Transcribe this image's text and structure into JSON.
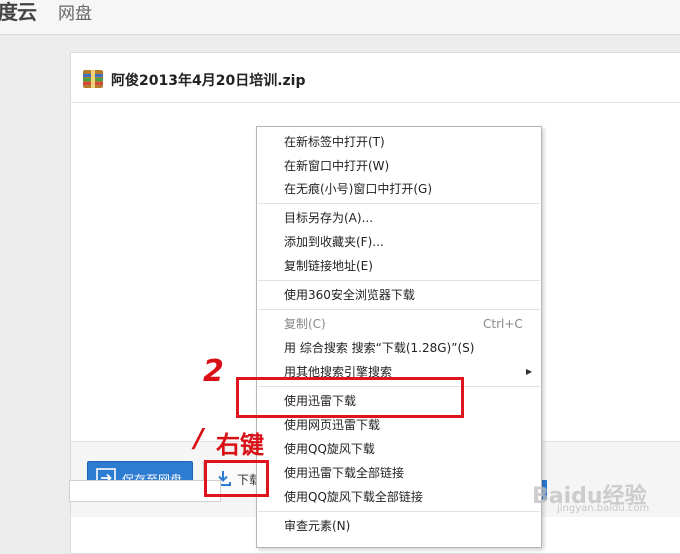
{
  "header": {
    "logo": "度云",
    "title": "网盘"
  },
  "file": {
    "name": "阿俊2013年4月20日培训.zip",
    "icon": "zip-archive-icon"
  },
  "actions": {
    "save_label": "保存至网盘",
    "download_label": "下载"
  },
  "context_menu": {
    "open_new_tab": "在新标签中打开(T)",
    "open_new_window": "在新窗口中打开(W)",
    "open_incognito": "在无痕(小号)窗口中打开(G)",
    "save_as": "目标另存为(A)...",
    "add_favorites": "添加到收藏夹(F)...",
    "copy_link": "复制链接地址(E)",
    "download_360": "使用360安全浏览器下载",
    "copy": "复制(C)",
    "copy_shortcut": "Ctrl+C",
    "search_selection": "用 综合搜索 搜索“下载(1.28G)”(S)",
    "other_search": "用其他搜索引擎搜索",
    "thunder_download": "使用迅雷下载",
    "web_thunder": "使用网页迅雷下载",
    "qq_download": "使用QQ旋风下载",
    "thunder_all": "使用迅雷下载全部链接",
    "qq_all": "使用QQ旋风下载全部链接",
    "inspect": "审查元素(N)"
  },
  "annotations": {
    "step2": "2",
    "step1": "/",
    "right_click": "右键",
    "color": "#d81016"
  },
  "watermark": {
    "text": "Baidu经验",
    "sub": "jingyan.baidu.com"
  },
  "colors": {
    "accent": "#2e7bd2",
    "highlight": "#e0141e"
  }
}
